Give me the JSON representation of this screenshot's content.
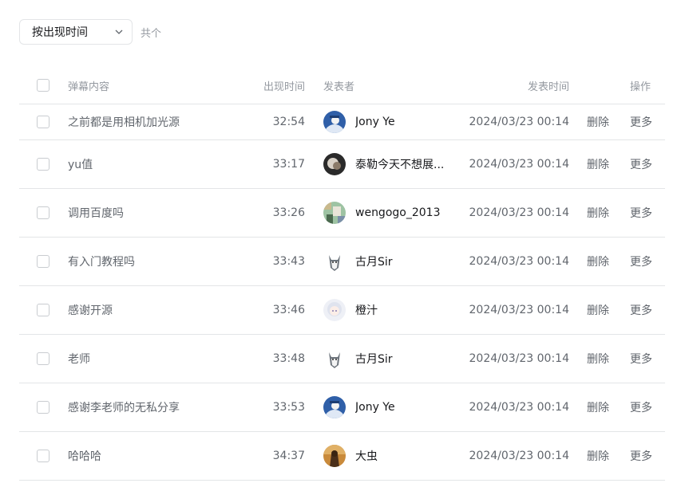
{
  "toolbar": {
    "sort_label": "按出现时间",
    "total_label": "共个"
  },
  "header": {
    "content": "弹幕内容",
    "time": "出现时间",
    "user": "发表者",
    "date": "发表时间",
    "actions": "操作"
  },
  "actions": {
    "delete": "删除",
    "more": "更多"
  },
  "rows": [
    {
      "content": "之前都是用相机加光源",
      "time": "32:54",
      "user": "Jony Ye",
      "date": "2024/03/23 00:14",
      "avatar": "blue-avatar-icon"
    },
    {
      "content": "yu值",
      "time": "33:17",
      "user": "泰勒今天不想展...",
      "date": "2024/03/23 00:14",
      "avatar": "dark-avatar-icon"
    },
    {
      "content": "调用百度吗",
      "time": "33:26",
      "user": "wengogo_2013",
      "date": "2024/03/23 00:14",
      "avatar": "mosaic-avatar-icon"
    },
    {
      "content": "有入门教程吗",
      "time": "33:43",
      "user": "古月Sir",
      "date": "2024/03/23 00:14",
      "avatar": "husky-avatar-icon"
    },
    {
      "content": "感谢开源",
      "time": "33:46",
      "user": "橙汁",
      "date": "2024/03/23 00:14",
      "avatar": "anime-avatar-icon"
    },
    {
      "content": "老师",
      "time": "33:48",
      "user": "古月Sir",
      "date": "2024/03/23 00:14",
      "avatar": "husky-avatar-icon"
    },
    {
      "content": "感谢李老师的无私分享",
      "time": "33:53",
      "user": "Jony Ye",
      "date": "2024/03/23 00:14",
      "avatar": "blue-avatar-icon"
    },
    {
      "content": "哈哈哈",
      "time": "34:37",
      "user": "大虫",
      "date": "2024/03/23 00:14",
      "avatar": "brown-avatar-icon"
    }
  ]
}
